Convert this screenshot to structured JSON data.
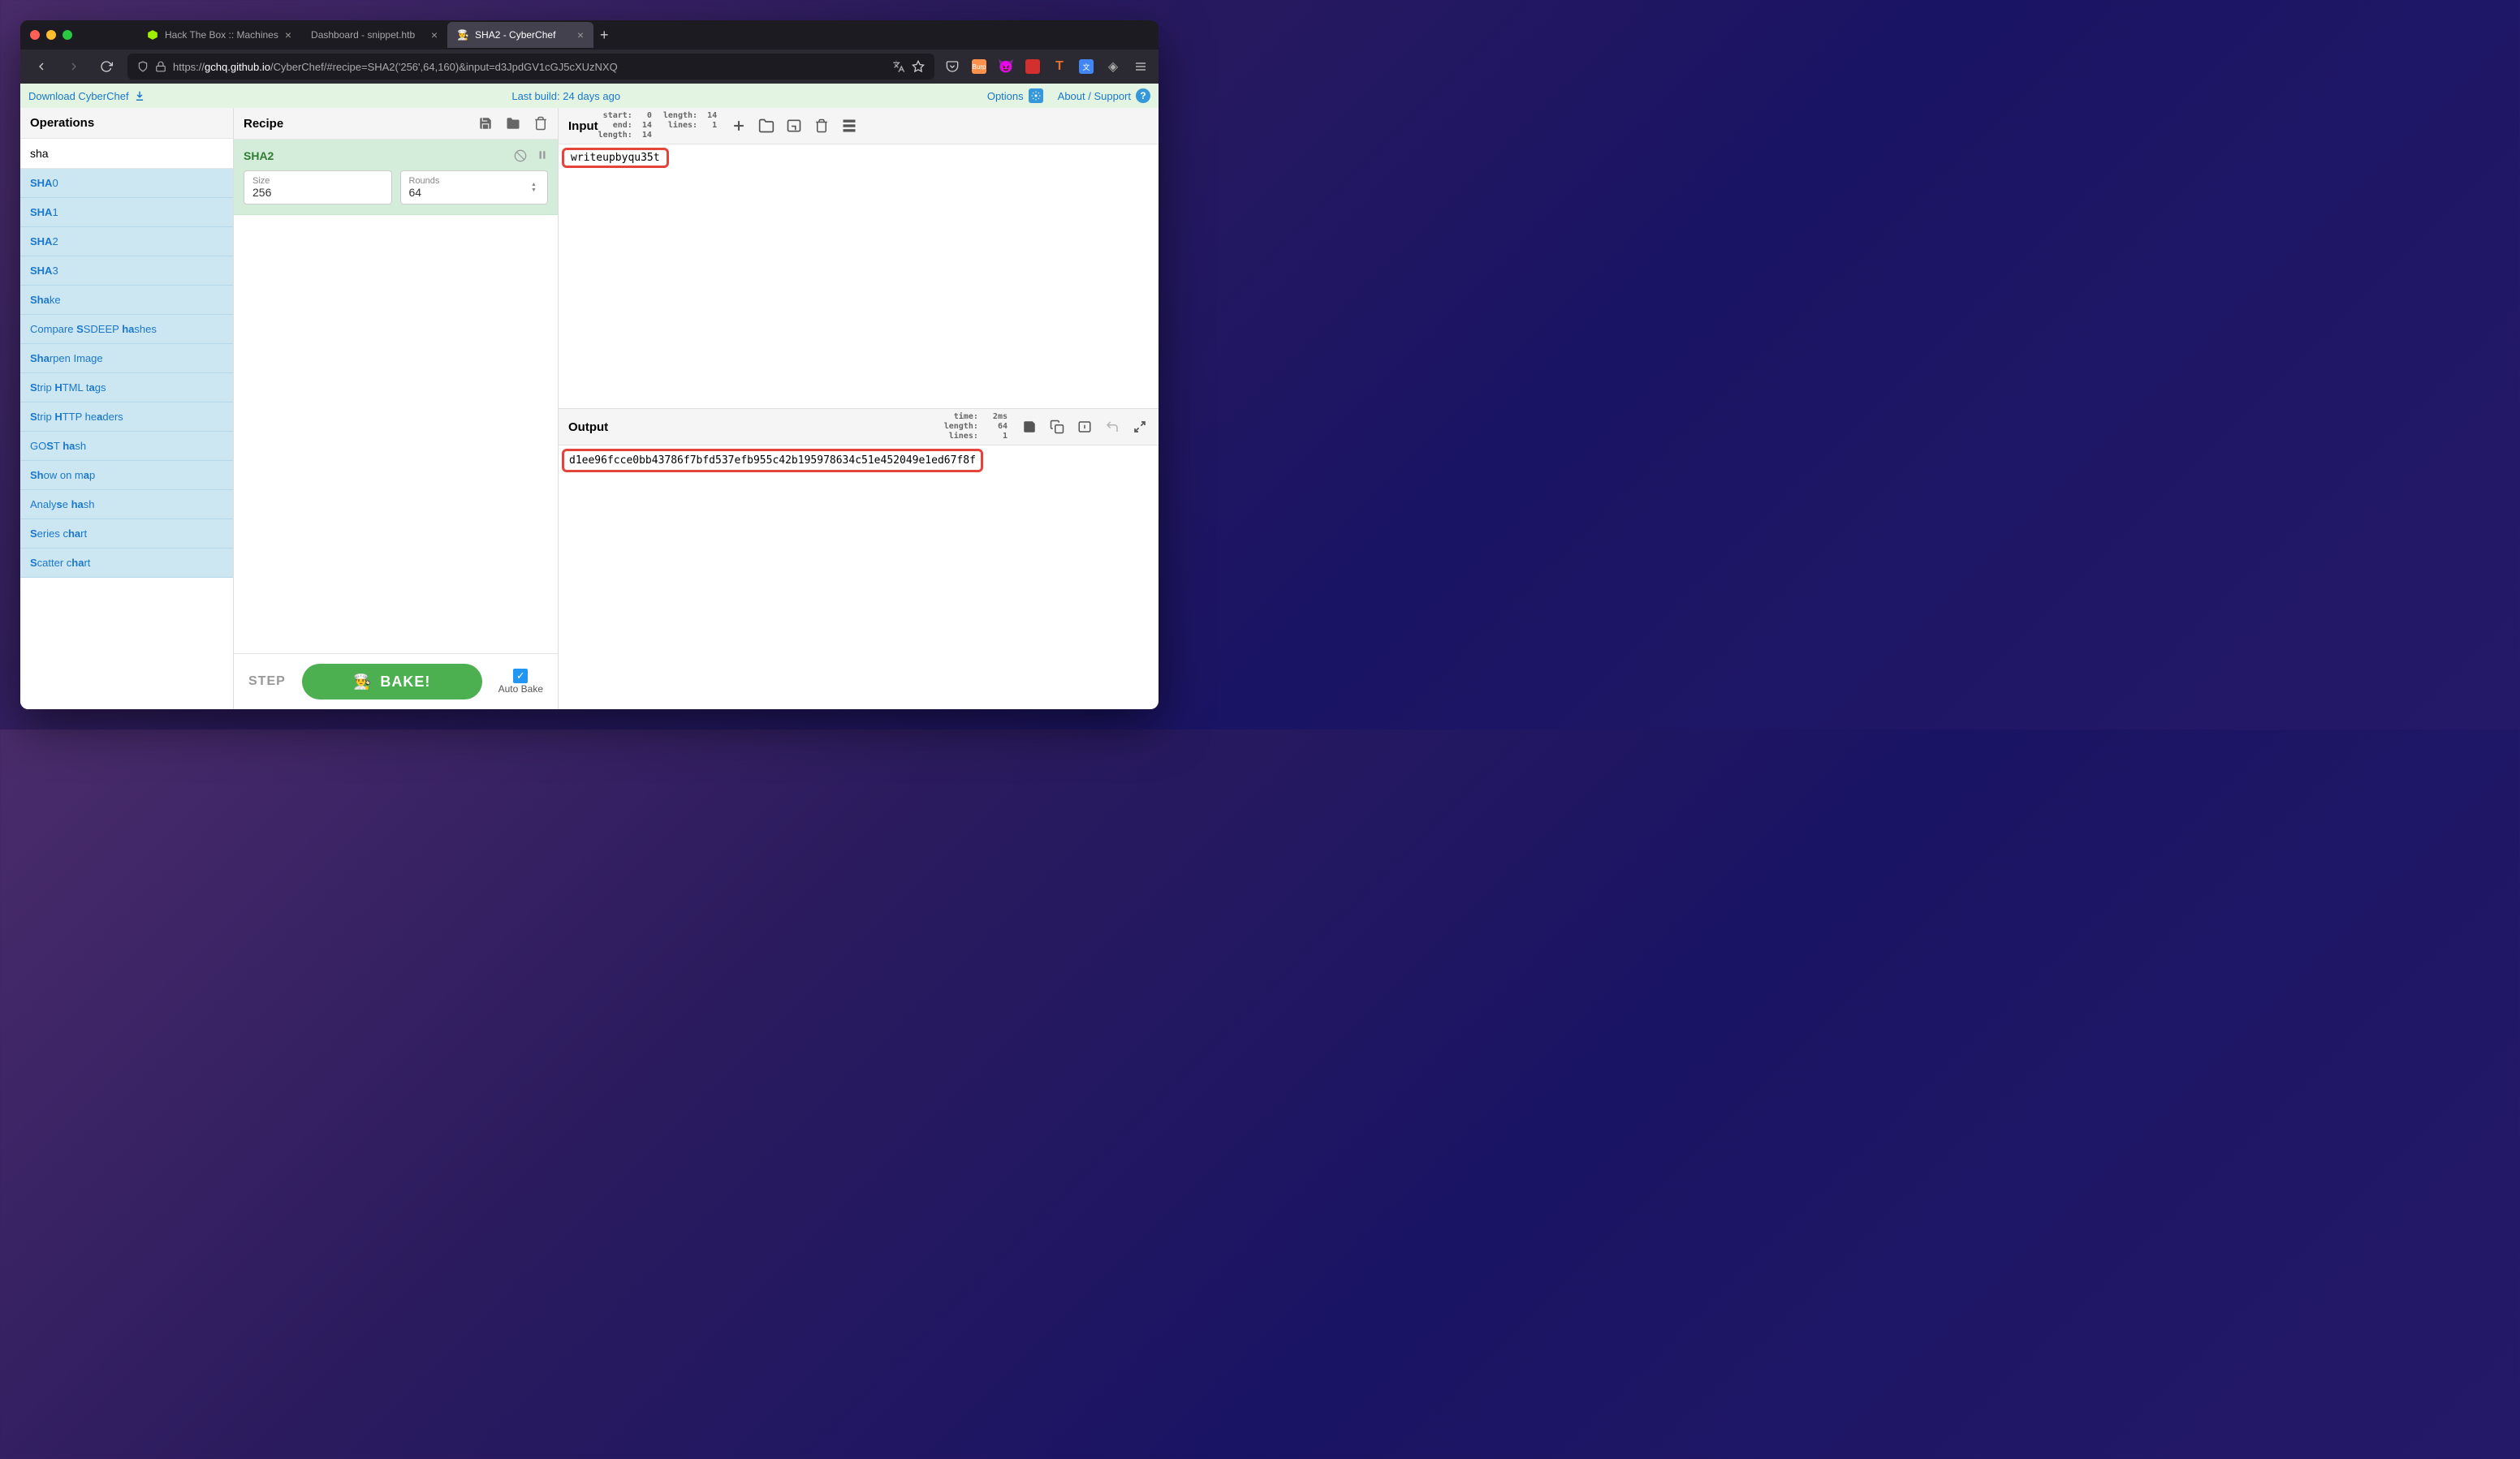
{
  "browser": {
    "tabs": [
      {
        "favicon": "htb",
        "title": "Hack The Box :: Machines"
      },
      {
        "favicon": "",
        "title": "Dashboard - snippet.htb"
      },
      {
        "favicon": "chef",
        "title": "SHA2 - CyberChef"
      }
    ],
    "url_prefix": "https://",
    "url_host": "gchq.github.io",
    "url_path": "/CyberChef/#recipe=SHA2('256',64,160)&input=d3JpdGV1cGJ5cXUzNXQ"
  },
  "header": {
    "download": "Download CyberChef",
    "lastbuild": "Last build: 24 days ago",
    "options": "Options",
    "about": "About / Support"
  },
  "operations": {
    "title": "Operations",
    "search": "sha",
    "items": [
      {
        "html": "<b>SHA</b>0"
      },
      {
        "html": "<b>SHA</b>1"
      },
      {
        "html": "<b>SHA</b>2"
      },
      {
        "html": "<b>SHA</b>3"
      },
      {
        "html": "<b>Sha</b>ke"
      },
      {
        "html": "Compare <b>S</b>SDEEP <b>ha</b>shes"
      },
      {
        "html": "<b>Sha</b>rpen Image"
      },
      {
        "html": "<b>S</b>trip <b>H</b>TML t<b>a</b>gs"
      },
      {
        "html": "<b>S</b>trip <b>H</b>TTP he<b>a</b>ders"
      },
      {
        "html": "GO<b>S</b>T <b>ha</b>sh"
      },
      {
        "html": "<b>Sh</b>ow on m<b>a</b>p"
      },
      {
        "html": "Analy<b>s</b>e <b>ha</b>sh"
      },
      {
        "html": "<b>S</b>eries c<b>ha</b>rt"
      },
      {
        "html": "<b>S</b>catter c<b>ha</b>rt"
      }
    ]
  },
  "recipe": {
    "title": "Recipe",
    "op": {
      "name": "SHA2",
      "size_label": "Size",
      "size_value": "256",
      "rounds_label": "Rounds",
      "rounds_value": "64"
    },
    "step": "STEP",
    "bake": "BAKE!",
    "autobake": "Auto Bake"
  },
  "io": {
    "input_title": "Input",
    "input_value": "writeupbyqu35t",
    "input_stats_left": " start:   0\n   end:  14\nlength:  14",
    "input_stats_right": "length:  14\n lines:   1",
    "output_title": "Output",
    "output_value": "d1ee96fcce0bb43786f7bfd537efb955c42b195978634c51e452049e1ed67f8f",
    "output_stats": "  time:   2ms\nlength:    64\n lines:     1"
  }
}
